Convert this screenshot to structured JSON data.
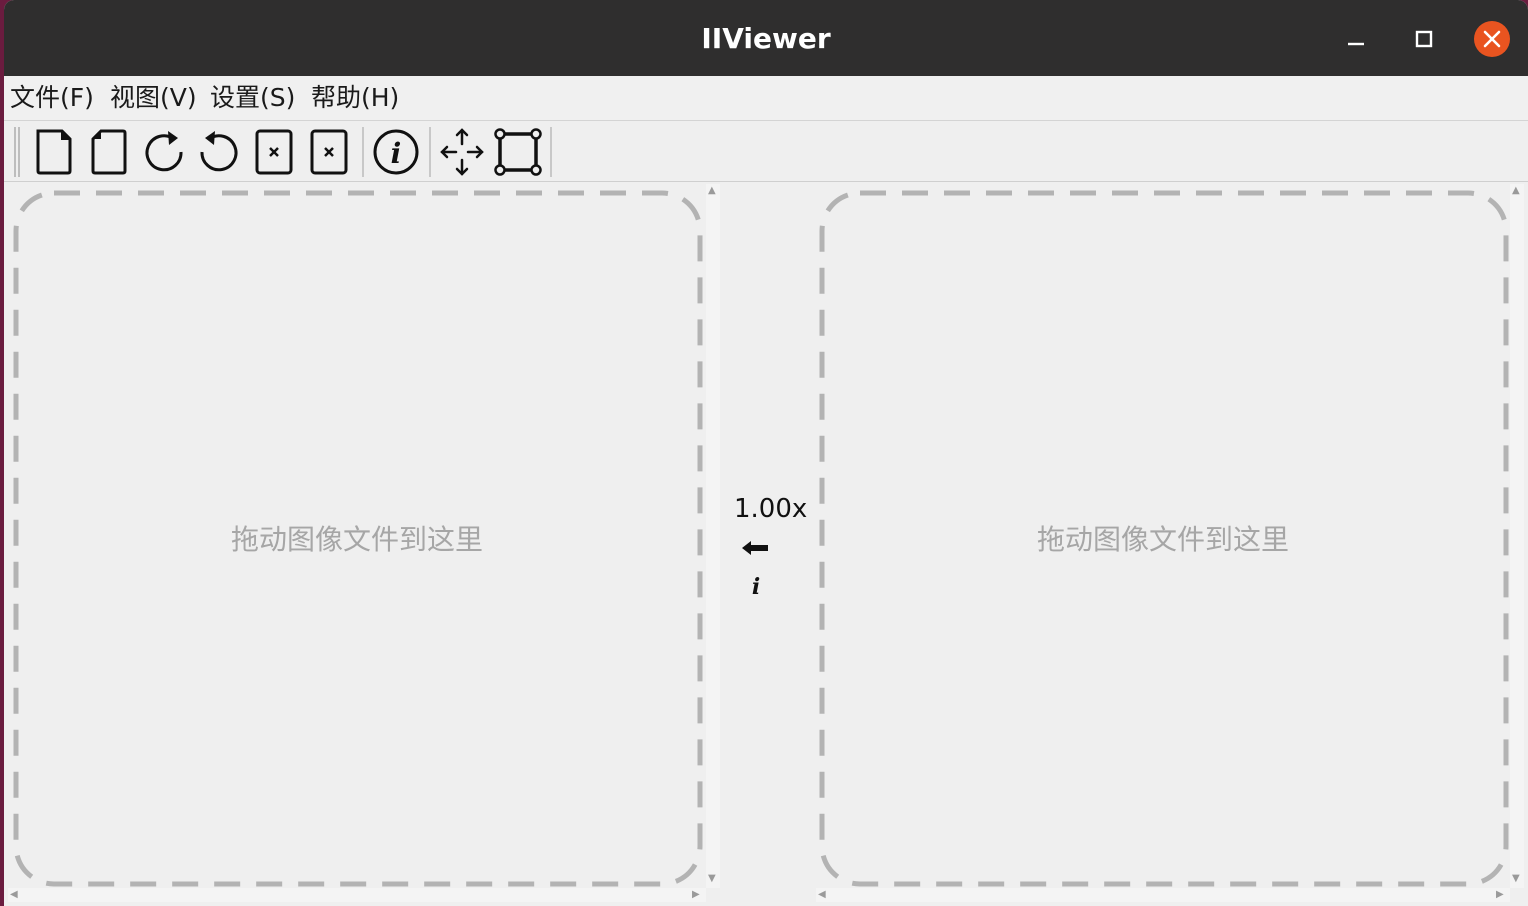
{
  "window": {
    "title": "IIViewer",
    "controls": {
      "minimize": "minimize-icon",
      "maximize": "maximize-icon",
      "close": "close-icon",
      "close_color": "#e95420"
    }
  },
  "menubar": {
    "items": [
      {
        "label": "文件(F)",
        "mnemonic": "F"
      },
      {
        "label": "视图(V)",
        "mnemonic": "V"
      },
      {
        "label": "设置(S)",
        "mnemonic": "S"
      },
      {
        "label": "帮助(H)",
        "mnemonic": "H"
      }
    ]
  },
  "toolbar": {
    "icons": [
      "new-file-icon",
      "open-file-icon",
      "rotate-clockwise-icon",
      "rotate-counterclockwise-icon",
      "close-left-image-icon",
      "close-right-image-icon",
      "info-icon",
      "move-icon",
      "crop-icon"
    ]
  },
  "left_pane": {
    "hint": "拖动图像文件到这里"
  },
  "right_pane": {
    "hint": "拖动图像文件到这里"
  },
  "center": {
    "zoom": "1.00x",
    "sync_icon": "arrow-left-icon",
    "info_icon": "info-icon"
  },
  "colors": {
    "titlebar": "#2f2e2e",
    "window_bg": "#efefef",
    "dash": "#b3b3b3",
    "hint_text": "#a6a6a6"
  }
}
